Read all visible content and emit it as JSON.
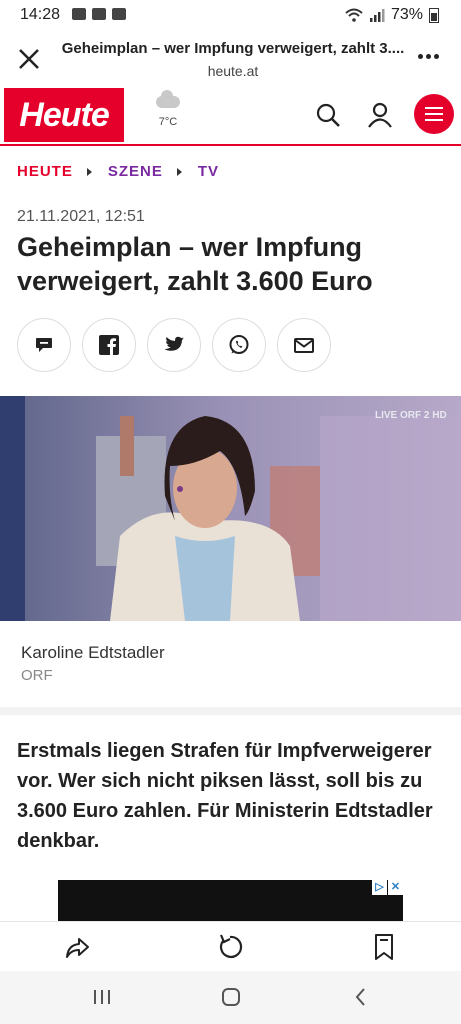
{
  "status_bar": {
    "time": "14:28",
    "battery": "73%"
  },
  "browser": {
    "title": "Geheimplan – wer Impfung verweigert, zahlt 3....",
    "url": "heute.at",
    "close_icon": "close-icon",
    "more_icon": "more-vertical-icon"
  },
  "site": {
    "logo_text": "Heute",
    "weather_temp": "7°C",
    "brand_color": "#e4002b"
  },
  "breadcrumb": [
    "HEUTE",
    "SZENE",
    "TV"
  ],
  "article": {
    "date": "21.11.2021, 12:51",
    "headline": "Geheimplan – wer Impfung verweigert, zahlt 3.600 Euro",
    "share_icons": [
      "comment-icon",
      "facebook-icon",
      "twitter-icon",
      "whatsapp-icon",
      "mail-icon"
    ],
    "photo_caption": "Karoline Edtstadler",
    "photo_source": "ORF",
    "photo_overlay": "LIVE ORF 2 HD",
    "lead": "Erstmals liegen Strafen für Impfverweigerer vor. Wer sich nicht piksen lässt, soll bis zu 3.600 Euro zahlen. Für Ministerin Edtstadler denkbar."
  },
  "toolbar": {
    "icons": [
      "share-icon",
      "reload-icon",
      "bookmark-icon"
    ]
  },
  "navbar": {
    "icons": [
      "recent-apps-icon",
      "home-icon",
      "back-icon"
    ]
  }
}
